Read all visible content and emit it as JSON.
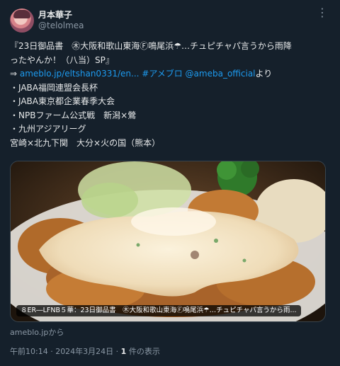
{
  "author": {
    "name": "月本華子",
    "handle": "@telolmea"
  },
  "tweet": {
    "line1": "『23日御品書　㊍大阪和歌山東海Ⓕ鳴尾浜☂…チュピチャパ言うから雨降",
    "line2": "ったやんか！（八当）SP』",
    "arrow": "⇒ ",
    "link_url": "ameblo.jp/eltshan0331/en...",
    "hashtag": " #アメブロ",
    "mention": " @ameba_official",
    "yori": "より",
    "bullets": [
      "・JABA福岡連盟会長杯",
      "・JABA東京都企業春季大会",
      "・NPBファーム公式戦　新潟×鶯",
      "・九州アジアリーグ"
    ],
    "last_line": "宮崎×北九下関　大分×火の国（熊本）"
  },
  "card": {
    "image_name": "fried-chicken-tartar-photo",
    "label": "８ER―LFNB５華：23日御品書　㊍大阪和歌山東海Ⓕ鳴尾浜☂…チュピチャパ言うから雨..."
  },
  "source": "ameblo.jpから",
  "meta": {
    "time": "午前10:14 · 2024年3月24日 · ",
    "count": "1",
    "count_suffix": " 件の表示"
  },
  "colors": {
    "background": "#15202b",
    "text": "#e7e9ea",
    "muted": "#8b98a5",
    "link": "#1d9bf0"
  }
}
